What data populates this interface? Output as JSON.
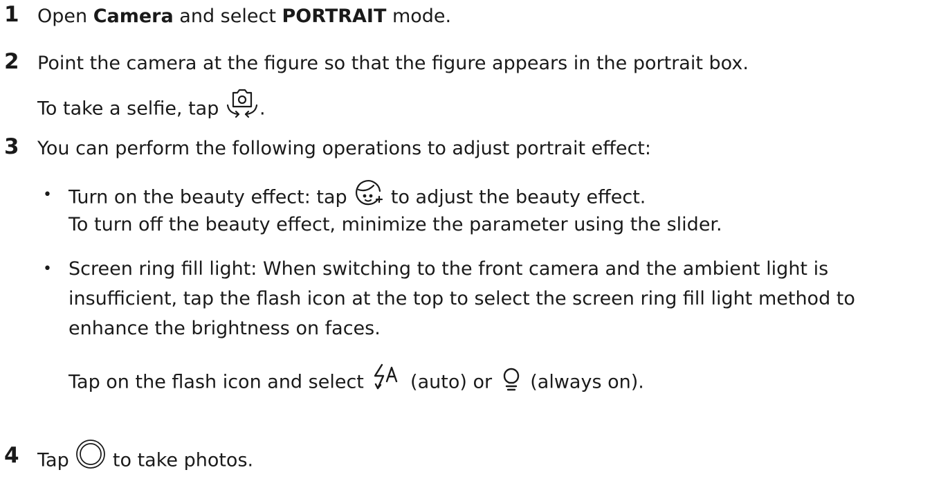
{
  "steps": [
    {
      "number": "1",
      "lines": [
        {
          "pre": "Open ",
          "b1": "Camera",
          "mid": " and select ",
          "b2": "PORTRAIT",
          "post": " mode."
        }
      ]
    },
    {
      "number": "2",
      "lines": [
        "Point the camera at the figure so that the figure appears in the portrait box.",
        {
          "pre": "To take a selfie, tap ",
          "icon": "switch-camera-icon",
          "post": "."
        }
      ]
    },
    {
      "number": "3",
      "lines": [
        "You can perform the following operations to adjust portrait effect:"
      ],
      "bullets": [
        {
          "marker": "•",
          "lines": [
            {
              "pre": "Turn on the beauty effect: tap ",
              "icon": "beauty-face-icon",
              "post": " to adjust the beauty effect."
            },
            "To turn off the beauty effect, minimize the parameter using the slider."
          ]
        },
        {
          "marker": "•",
          "lines": [
            "Screen ring fill light: When switching to the front camera and the ambient light is",
            "insufficient, tap the flash icon at the top to select the screen ring fill light method to",
            "enhance the brightness on faces.",
            {
              "pre": "Tap on the flash icon and select ",
              "icon1": "flash-auto-icon",
              "mid": " (auto) or ",
              "icon2": "fill-light-bulb-icon",
              "post": " (always on)."
            }
          ]
        }
      ]
    },
    {
      "number": "4",
      "lines": [
        {
          "pre": "Tap ",
          "icon": "shutter-icon",
          "post": " to take photos."
        }
      ]
    }
  ]
}
